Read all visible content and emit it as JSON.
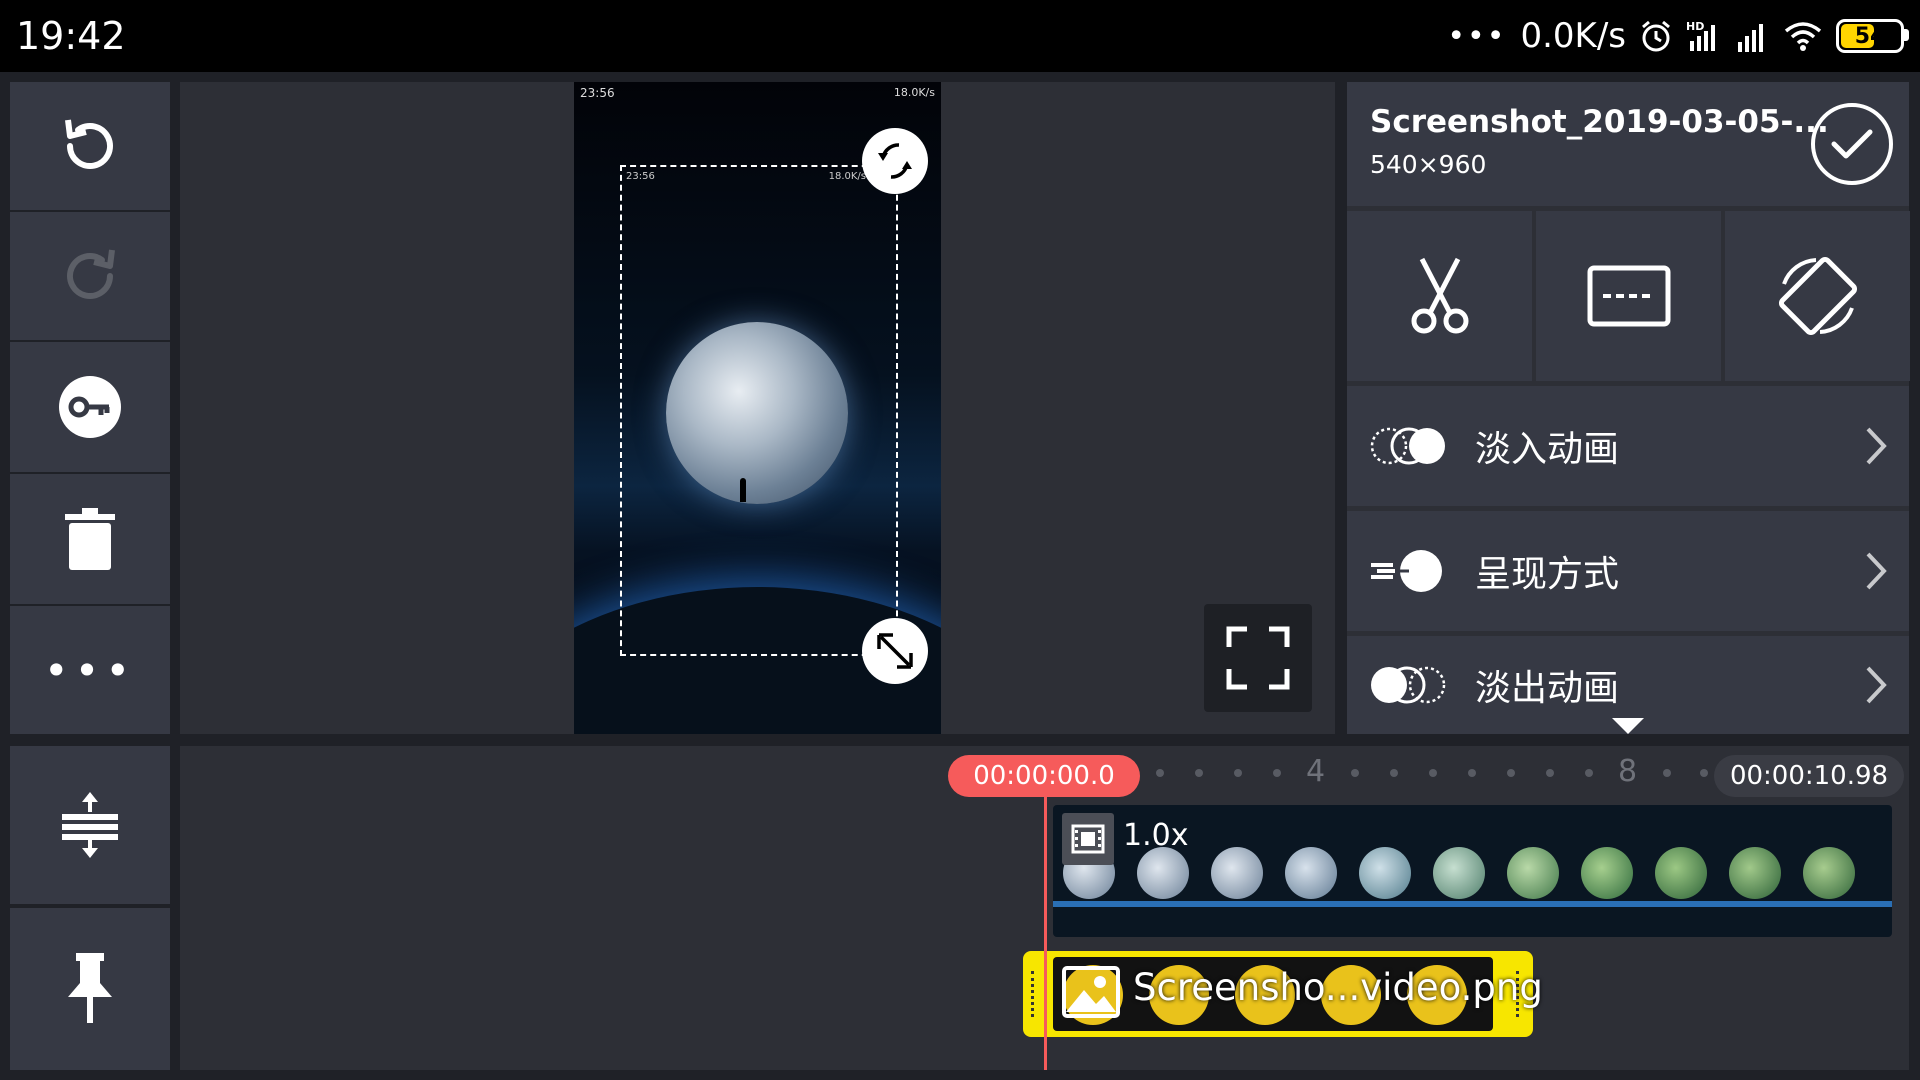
{
  "status_bar": {
    "time": "19:42",
    "network_speed": "0.0K/s",
    "overflow": "•••",
    "battery_level": "54",
    "icons": [
      "alarm-icon",
      "hd-signal-icon",
      "signal-icon",
      "wifi-icon",
      "battery-icon"
    ]
  },
  "left_toolbar": {
    "icons": [
      "undo-icon",
      "redo-icon",
      "keyframe-icon",
      "delete-icon",
      "more-icon"
    ],
    "more_label": "•••"
  },
  "timeline_tools": {
    "icons": [
      "split-track-icon",
      "pin-icon"
    ]
  },
  "preview": {
    "embedded_status": {
      "time": "23:56",
      "speed": "18.0K/s"
    },
    "crop_overlay_status": {
      "time": "23:56",
      "speed": "18.0K/s"
    },
    "icons": [
      "rotate-handle-icon",
      "resize-handle-icon",
      "fullscreen-icon"
    ]
  },
  "clip_panel": {
    "title": "Screenshot_2019-03-05-...",
    "resolution": "540×960",
    "tools": [
      "trim-icon",
      "crop-icon",
      "rotate-icon"
    ],
    "rows": [
      {
        "label": "淡入动画",
        "icon": "fade-in-icon"
      },
      {
        "label": "呈现方式",
        "icon": "presentation-icon"
      },
      {
        "label": "淡出动画",
        "icon": "fade-out-icon"
      }
    ]
  },
  "timeline": {
    "current_time": "00:00:00.0",
    "duration": "00:00:10.98",
    "ruler_labels": [
      "4",
      "8"
    ],
    "video_track": {
      "speed": "1.0x"
    },
    "image_clip": {
      "label": "Screensho...video.png"
    }
  },
  "colors": {
    "accent_red": "#f65b5b",
    "clip_yellow": "#f7e600",
    "panel": "#363944",
    "background": "#2d2f36"
  }
}
